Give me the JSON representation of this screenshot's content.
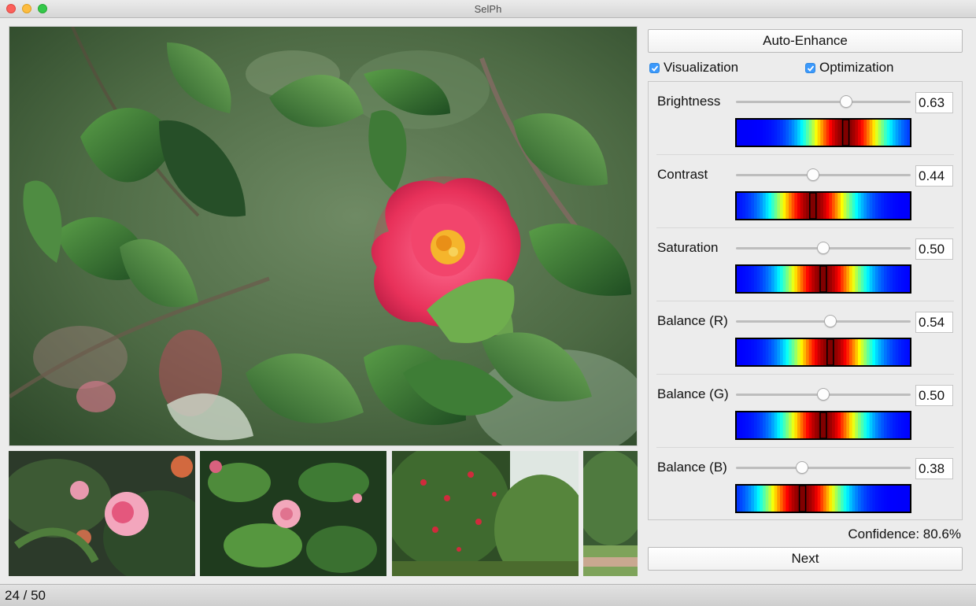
{
  "window": {
    "title": "SelPh"
  },
  "buttons": {
    "auto_enhance": "Auto-Enhance",
    "next": "Next"
  },
  "checkboxes": [
    {
      "label": "Visualization",
      "checked": true
    },
    {
      "label": "Optimization",
      "checked": true
    }
  ],
  "parameters": [
    {
      "label": "Brightness",
      "value": "0.63",
      "level": 0.63,
      "heat_peak": 0.63
    },
    {
      "label": "Contrast",
      "value": "0.44",
      "level": 0.44,
      "heat_peak": 0.44
    },
    {
      "label": "Saturation",
      "value": "0.50",
      "level": 0.5,
      "heat_peak": 0.5
    },
    {
      "label": "Balance (R)",
      "value": "0.54",
      "level": 0.54,
      "heat_peak": 0.54
    },
    {
      "label": "Balance (G)",
      "value": "0.50",
      "level": 0.5,
      "heat_peak": 0.5
    },
    {
      "label": "Balance (B)",
      "value": "0.38",
      "level": 0.38,
      "heat_peak": 0.38
    }
  ],
  "confidence": "Confidence: 80.6%",
  "status": {
    "counter": "24 / 50"
  },
  "colors": {
    "accent": "#3b99fc",
    "heat_low": "#1a24d6",
    "heat_high": "#d40000",
    "leaf": "#2d6a2f",
    "flower": "#e8315a"
  }
}
